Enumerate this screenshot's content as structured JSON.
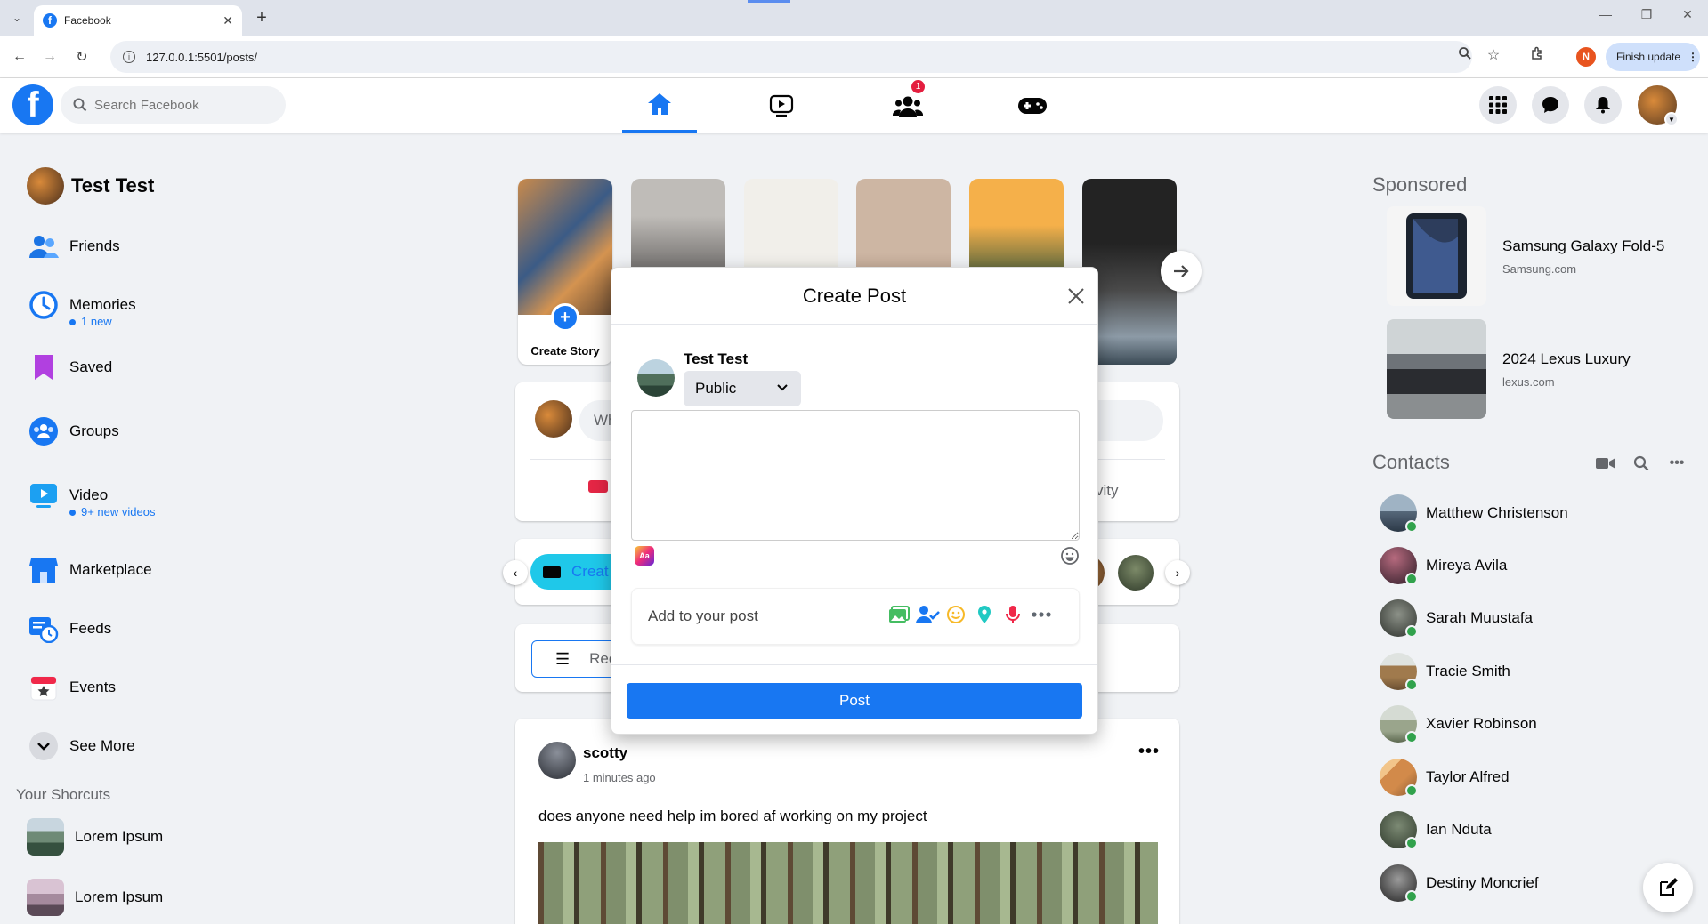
{
  "browser": {
    "tab_title": "Facebook",
    "url": "127.0.0.1:5501/posts/",
    "profile_initial": "N",
    "finish_update_label": "Finish update",
    "favicon_letter": "f"
  },
  "header": {
    "logo_letter": "f",
    "search_placeholder": "Search Facebook",
    "friends_badge": "1"
  },
  "sidebar": {
    "user_name": "Test Test",
    "items": [
      {
        "label": "Friends"
      },
      {
        "label": "Memories",
        "sub": "1 new"
      },
      {
        "label": "Saved"
      },
      {
        "label": "Groups"
      },
      {
        "label": "Video",
        "sub": "9+ new videos"
      },
      {
        "label": "Marketplace"
      },
      {
        "label": "Feeds"
      },
      {
        "label": "Events"
      },
      {
        "label": "See More"
      }
    ],
    "shortcuts_title": "Your Shorcuts",
    "shortcuts": [
      {
        "label": "Lorem Ipsum"
      },
      {
        "label": "Lorem Ipsum"
      }
    ]
  },
  "stories": {
    "create_label": "Create Story"
  },
  "composer": {
    "placeholder_fragment": "Wh",
    "activity_fragment": "vity"
  },
  "rooms": {
    "create_fragment": "Creat"
  },
  "filters": {
    "recent_fragment": "Rec"
  },
  "post": {
    "author": "scotty",
    "time": "1 minutes ago",
    "text": "does anyone need help im bored af working on my project",
    "more_label": "•••"
  },
  "right": {
    "sponsored_title": "Sponsored",
    "ads": [
      {
        "title": "Samsung Galaxy Fold-5",
        "site": "Samsung.com"
      },
      {
        "title": "2024 Lexus Luxury",
        "site": "lexus.com"
      }
    ],
    "contacts_title": "Contacts",
    "contacts": [
      {
        "name": "Matthew Christenson"
      },
      {
        "name": "Mireya Avila"
      },
      {
        "name": "Sarah Muustafa"
      },
      {
        "name": "Tracie Smith"
      },
      {
        "name": "Xavier Robinson"
      },
      {
        "name": "Taylor Alfred"
      },
      {
        "name": "Ian Nduta"
      },
      {
        "name": "Destiny Moncrief"
      }
    ]
  },
  "modal": {
    "title": "Create Post",
    "user_name": "Test Test",
    "privacy": "Public",
    "text_value": "",
    "aa_label": "Aa",
    "add_to_post": "Add to your post",
    "post_button": "Post"
  },
  "colors": {
    "brand": "#1877f2",
    "background": "#f0f2f5",
    "online": "#31a24c"
  }
}
